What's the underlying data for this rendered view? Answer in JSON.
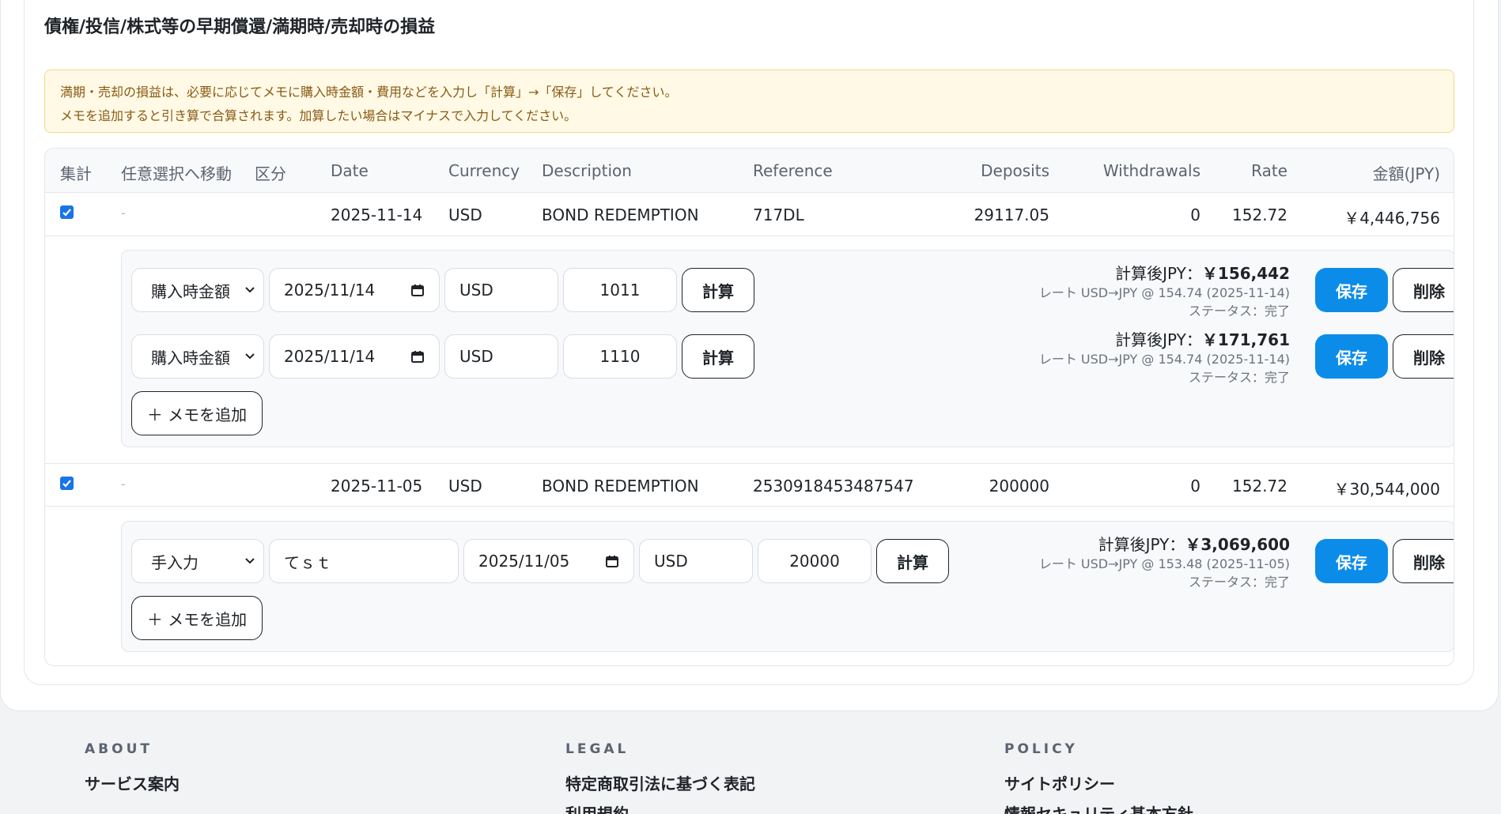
{
  "section": {
    "title": "債権/投信/株式等の早期償還/満期時/売却時の損益",
    "notice_line1": "満期・売却の損益は、必要に応じてメモに購入時金額・費用などを入力し「計算」→「保存」してください。",
    "notice_line2": "メモを追加すると引き算で合算されます。加算したい場合はマイナスで入力してください。"
  },
  "table": {
    "headers": [
      "集計",
      "任意選択へ移動",
      "区分",
      "Date",
      "Currency",
      "Description",
      "Reference",
      "Deposits",
      "Withdrawals",
      "Rate",
      "金額(JPY)"
    ],
    "rows": [
      {
        "checked": true,
        "move": "-",
        "category": "",
        "date": "2025-11-14",
        "currency": "USD",
        "description": "BOND REDEMPTION",
        "reference": "717DL",
        "deposits": "29117.05",
        "withdrawals": "0",
        "rate": "152.72",
        "amount_jpy": "￥4,446,756",
        "memos": [
          {
            "type": "購入時金額",
            "date": "2025/11/14",
            "currency": "USD",
            "amount": "1011",
            "calc_label": "計算",
            "result_label": "計算後JPY：",
            "result_value": "￥156,442",
            "rate_text": "レート USD→JPY @ 154.74 (2025-11-14)",
            "status_text": "ステータス：完了",
            "save_label": "保存",
            "delete_label": "削除"
          },
          {
            "type": "購入時金額",
            "date": "2025/11/14",
            "currency": "USD",
            "amount": "1110",
            "calc_label": "計算",
            "result_label": "計算後JPY：",
            "result_value": "￥171,761",
            "rate_text": "レート USD→JPY @ 154.74 (2025-11-14)",
            "status_text": "ステータス：完了",
            "save_label": "保存",
            "delete_label": "削除"
          }
        ],
        "add_memo_label": "＋ メモを追加"
      },
      {
        "checked": true,
        "move": "-",
        "category": "",
        "date": "2025-11-05",
        "currency": "USD",
        "description": "BOND REDEMPTION",
        "reference": "2530918453487547",
        "deposits": "200000",
        "withdrawals": "0",
        "rate": "152.72",
        "amount_jpy": "￥30,544,000",
        "memos": [
          {
            "type": "手入力",
            "note": "てｓｔ",
            "date": "2025/11/05",
            "currency": "USD",
            "amount": "20000",
            "calc_label": "計算",
            "result_label": "計算後JPY：",
            "result_value": "￥3,069,600",
            "rate_text": "レート USD→JPY @ 153.48 (2025-11-05)",
            "status_text": "ステータス：完了",
            "save_label": "保存",
            "delete_label": "削除"
          }
        ],
        "add_memo_label": "＋ メモを追加"
      }
    ]
  },
  "footer": {
    "about": {
      "heading": "ABOUT",
      "links": [
        "サービス案内"
      ]
    },
    "legal": {
      "heading": "LEGAL",
      "links": [
        "特定商取引法に基づく表記",
        "利用規約"
      ]
    },
    "policy": {
      "heading": "POLICY",
      "links": [
        "サイトポリシー",
        "情報セキュリティ基本方針"
      ]
    }
  },
  "colors": {
    "primary": "#0c8ce9",
    "notice_bg": "#fff9e6",
    "notice_text": "#8a5a12",
    "checkbox": "#1a73e8"
  }
}
